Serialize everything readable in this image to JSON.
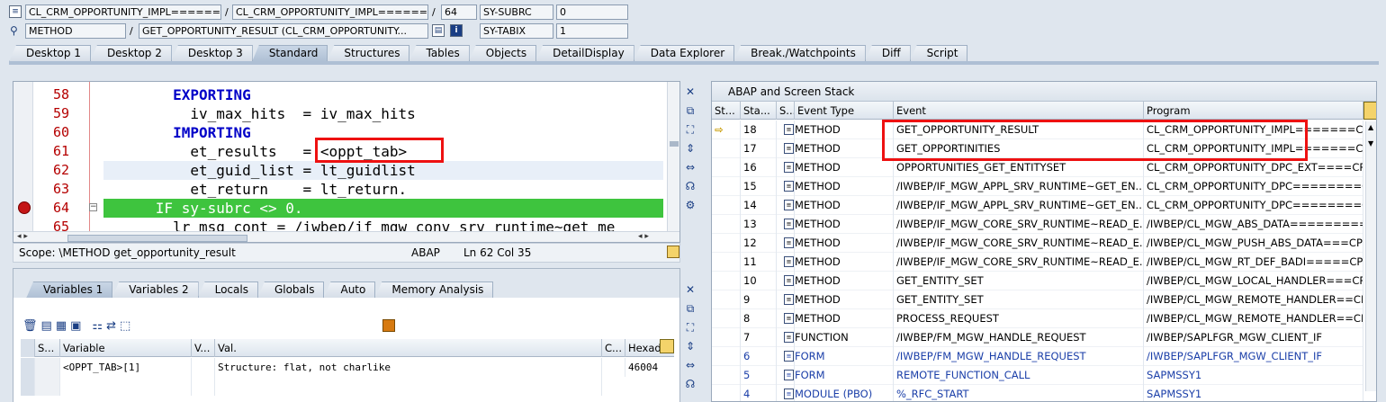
{
  "header": {
    "row1": {
      "program": "CL_CRM_OPPORTUNITY_IMPL=======...",
      "include": "CL_CRM_OPPORTUNITY_IMPL=======...",
      "line": "64",
      "var_name": "SY-SUBRC",
      "var_value": "0"
    },
    "row2": {
      "type": "METHOD",
      "event": "GET_OPPORTUNITY_RESULT (CL_CRM_OPPORTUNITY...",
      "var_name": "SY-TABIX",
      "var_value": "1"
    },
    "sep": "/"
  },
  "tabs": [
    "Desktop 1",
    "Desktop 2",
    "Desktop 3",
    "Standard",
    "Structures",
    "Tables",
    "Objects",
    "DetailDisplay",
    "Data Explorer",
    "Break./Watchpoints",
    "Diff",
    "Script"
  ],
  "editor": {
    "lines": [
      {
        "num": "58",
        "indent": "        ",
        "text": "EXPORTING",
        "kw": true
      },
      {
        "num": "59",
        "indent": "          ",
        "text": "iv_max_hits  = iv_max_hits",
        "kw": false
      },
      {
        "num": "60",
        "indent": "        ",
        "text": "IMPORTING",
        "kw": true
      },
      {
        "num": "61",
        "indent": "          ",
        "text": "et_results   = <oppt_tab>",
        "kw": false
      },
      {
        "num": "62",
        "indent": "          ",
        "text": "et_guid_list = lt_guidlist",
        "kw": false
      },
      {
        "num": "63",
        "indent": "          ",
        "text": "et_return    = lt_return.",
        "kw": false
      },
      {
        "num": "64",
        "indent": "      ",
        "text": "IF sy-subrc <> 0.",
        "kw": false
      },
      {
        "num": "65",
        "indent": "        ",
        "text": "lr_msg_cont = /iwbep/if_mgw_conv_srv_runtime~get_me",
        "kw": false
      }
    ],
    "scope": "Scope: \\METHOD get_opportunity_result",
    "lang": "ABAP",
    "pos": "Ln  62 Col  35"
  },
  "vars": {
    "tabs": [
      "Variables 1",
      "Variables 2",
      "Locals",
      "Globals",
      "Auto",
      "Memory Analysis"
    ],
    "headers": [
      "S...",
      "Variable",
      "V...",
      "Val.",
      "C...",
      "Hexad"
    ],
    "rows": [
      {
        "variable": "<OPPT_TAB>[1]",
        "value": "Structure: flat, not charlike",
        "hex": "46004"
      }
    ]
  },
  "stack": {
    "title": "ABAP and Screen Stack",
    "headers": [
      "St...",
      "Sta...",
      "S...",
      "Event Type",
      "Event",
      "Program"
    ],
    "rows": [
      {
        "n": "18",
        "type": "METHOD",
        "event": "GET_OPPORTUNITY_RESULT",
        "program": "CL_CRM_OPPORTUNITY_IMPL=======CP",
        "current": true,
        "blue": false
      },
      {
        "n": "17",
        "type": "METHOD",
        "event": "GET_OPPORTINITIES",
        "program": "CL_CRM_OPPORTUNITY_IMPL=======CP",
        "current": false,
        "blue": false
      },
      {
        "n": "16",
        "type": "METHOD",
        "event": "OPPORTUNITIES_GET_ENTITYSET",
        "program": "CL_CRM_OPPORTUNITY_DPC_EXT====CP",
        "current": false,
        "blue": false
      },
      {
        "n": "15",
        "type": "METHOD",
        "event": "/IWBEP/IF_MGW_APPL_SRV_RUNTIME~GET_EN...",
        "program": "CL_CRM_OPPORTUNITY_DPC========C",
        "current": false,
        "blue": false
      },
      {
        "n": "14",
        "type": "METHOD",
        "event": "/IWBEP/IF_MGW_APPL_SRV_RUNTIME~GET_EN...",
        "program": "CL_CRM_OPPORTUNITY_DPC========C",
        "current": false,
        "blue": false
      },
      {
        "n": "13",
        "type": "METHOD",
        "event": "/IWBEP/IF_MGW_CORE_SRV_RUNTIME~READ_E...",
        "program": "/IWBEP/CL_MGW_ABS_DATA=========C",
        "current": false,
        "blue": false
      },
      {
        "n": "12",
        "type": "METHOD",
        "event": "/IWBEP/IF_MGW_CORE_SRV_RUNTIME~READ_E...",
        "program": "/IWBEP/CL_MGW_PUSH_ABS_DATA===CP",
        "current": false,
        "blue": false
      },
      {
        "n": "11",
        "type": "METHOD",
        "event": "/IWBEP/IF_MGW_CORE_SRV_RUNTIME~READ_E...",
        "program": "/IWBEP/CL_MGW_RT_DEF_BADI=====CP",
        "current": false,
        "blue": false
      },
      {
        "n": "10",
        "type": "METHOD",
        "event": "GET_ENTITY_SET",
        "program": "/IWBEP/CL_MGW_LOCAL_HANDLER===CP",
        "current": false,
        "blue": false
      },
      {
        "n": "9",
        "type": "METHOD",
        "event": "GET_ENTITY_SET",
        "program": "/IWBEP/CL_MGW_REMOTE_HANDLER==CP",
        "current": false,
        "blue": false
      },
      {
        "n": "8",
        "type": "METHOD",
        "event": "PROCESS_REQUEST",
        "program": "/IWBEP/CL_MGW_REMOTE_HANDLER==CP",
        "current": false,
        "blue": false
      },
      {
        "n": "7",
        "type": "FUNCTION",
        "event": "/IWBEP/FM_MGW_HANDLE_REQUEST",
        "program": "/IWBEP/SAPLFGR_MGW_CLIENT_IF",
        "current": false,
        "blue": false
      },
      {
        "n": "6",
        "type": "FORM",
        "event": "/IWBEP/FM_MGW_HANDLE_REQUEST",
        "program": "/IWBEP/SAPLFGR_MGW_CLIENT_IF",
        "current": false,
        "blue": true
      },
      {
        "n": "5",
        "type": "FORM",
        "event": "REMOTE_FUNCTION_CALL",
        "program": "SAPMSSY1",
        "current": false,
        "blue": true
      },
      {
        "n": "4",
        "type": "MODULE (PBO)",
        "event": "%_RFC_START",
        "program": "SAPMSSY1",
        "current": false,
        "blue": true
      }
    ]
  },
  "colors": {
    "highlight": "#3ec43e",
    "annotation": "#e11111",
    "keyword": "#0000c8",
    "linenum": "#b50000"
  }
}
